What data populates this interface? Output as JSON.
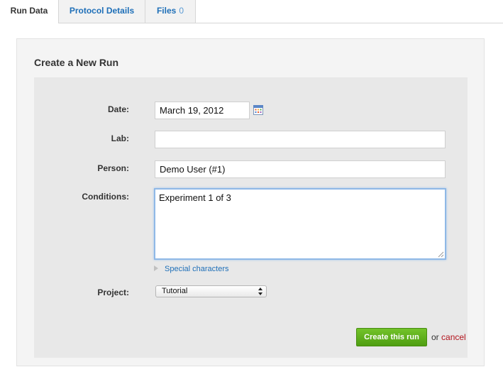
{
  "tabs": [
    {
      "label": "Run Data"
    },
    {
      "label": "Protocol Details"
    },
    {
      "label": "Files",
      "count": "0"
    }
  ],
  "panel": {
    "title": "Create a New Run"
  },
  "form": {
    "date_label": "Date:",
    "date_value": "March 19, 2012",
    "lab_label": "Lab:",
    "lab_value": "",
    "person_label": "Person:",
    "person_value": "Demo User (#1)",
    "conditions_label": "Conditions:",
    "conditions_value": "Experiment 1 of 3",
    "special_characters": "Special characters",
    "project_label": "Project:",
    "project_selected": "Tutorial"
  },
  "actions": {
    "create_label": "Create this run",
    "or_text": "or",
    "cancel_label": "cancel"
  },
  "icons": {
    "calendar": "calendar-icon",
    "disclosure": "triangle-right-icon",
    "select_arrows": "updown-arrows-icon"
  },
  "colors": {
    "link": "#1e6fb8",
    "create_button": "#5aab1b",
    "cancel": "#b3141d",
    "focus": "#8fb8e6"
  }
}
